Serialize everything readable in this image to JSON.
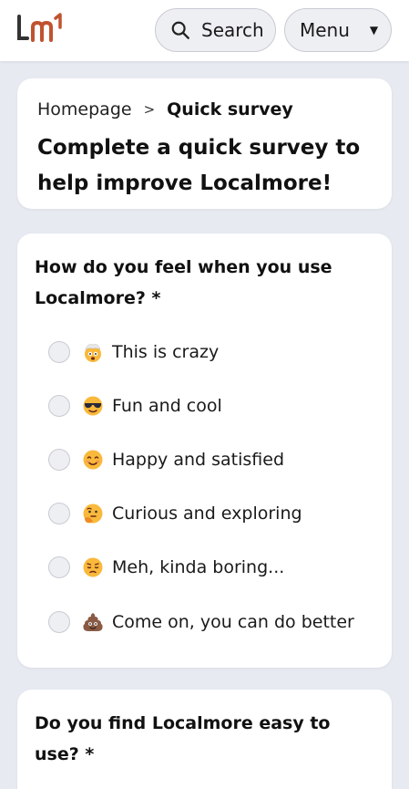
{
  "header": {
    "logo_text": "lm",
    "search_label": "Search",
    "menu_label": "Menu",
    "accent": "#c0532f"
  },
  "breadcrumb": {
    "home": "Homepage",
    "separator": ">",
    "current": "Quick survey"
  },
  "page_title": "Complete a quick survey to help improve Localmore!",
  "questions": [
    {
      "title": "How do you feel when you use Localmore? *",
      "options": [
        {
          "label": "This is crazy",
          "icon": "exploding-head-emoji"
        },
        {
          "label": "Fun and cool",
          "icon": "sunglasses-emoji"
        },
        {
          "label": "Happy and satisfied",
          "icon": "smiling-face-emoji"
        },
        {
          "label": "Curious and exploring",
          "icon": "thinking-face-emoji"
        },
        {
          "label": "Meh, kinda boring...",
          "icon": "pensive-face-emoji"
        },
        {
          "label": "Come on, you can do better",
          "icon": "poop-emoji"
        }
      ]
    },
    {
      "title": "Do you find Localmore easy to use? *"
    }
  ]
}
